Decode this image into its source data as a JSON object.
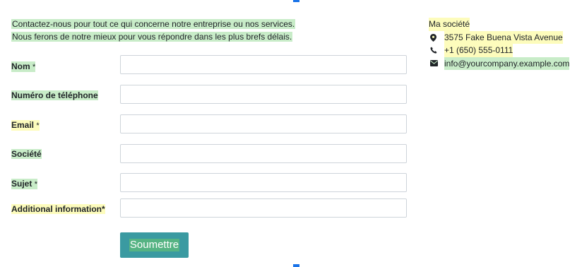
{
  "intro": {
    "line1": "Contactez-nous pour tout ce qui concerne notre entreprise ou nos services.",
    "line2": "Nous ferons de notre mieux pour vous répondre dans les plus brefs délais."
  },
  "form": {
    "fields": [
      {
        "label": "Nom",
        "required_mark": "*",
        "value": ""
      },
      {
        "label": "Numéro de téléphone",
        "required_mark": "",
        "value": ""
      },
      {
        "label": "Email",
        "required_mark": "*",
        "value": ""
      },
      {
        "label": "Société",
        "required_mark": "",
        "value": ""
      },
      {
        "label": "Sujet",
        "required_mark": "*",
        "value": ""
      },
      {
        "label": "Additional information*",
        "required_mark": "",
        "value": ""
      }
    ],
    "submit_label": "Soumettre"
  },
  "company": {
    "name": "Ma société",
    "address": "3575 Fake Buena Vista Avenue",
    "phone": "+1 (650) 555-0111",
    "email": "info@yourcompany.example.com",
    "icons": [
      "map-marker-icon",
      "phone-icon",
      "envelope-icon"
    ]
  },
  "colors": {
    "button": "#3a9aa1",
    "highlight_green": "#c8ecc8",
    "highlight_yellow": "#fdfcbc",
    "accent_blue": "#1a73e8"
  }
}
